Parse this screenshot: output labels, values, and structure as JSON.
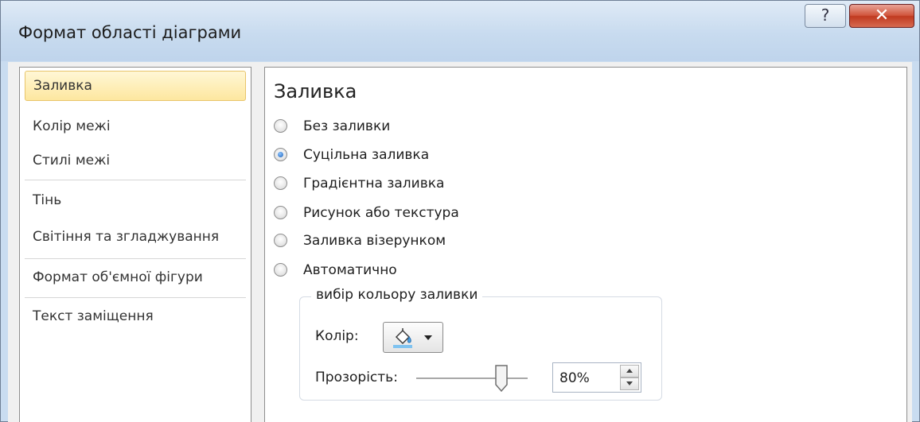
{
  "window": {
    "title": "Формат області діаграми",
    "help_glyph": "?",
    "close_glyph": "✕"
  },
  "sidebar": {
    "items": [
      {
        "label": "Заливка",
        "selected": true
      },
      {
        "label": "Колір межі",
        "selected": false
      },
      {
        "label": "Стилі межі",
        "selected": false
      },
      {
        "label": "Тінь",
        "selected": false
      },
      {
        "label": "Світіння та згладжування",
        "selected": false
      },
      {
        "label": "Формат об'ємної фігури",
        "selected": false
      },
      {
        "label": "Текст заміщення",
        "selected": false
      }
    ]
  },
  "content": {
    "section_title": "Заливка",
    "options": [
      {
        "label": "Без заливки",
        "selected": false
      },
      {
        "label": "Суцільна заливка",
        "selected": true
      },
      {
        "label": "Градієнтна заливка",
        "selected": false
      },
      {
        "label": "Рисунок або текстура",
        "selected": false
      },
      {
        "label": "Заливка візерунком",
        "selected": false
      },
      {
        "label": "Автоматично",
        "selected": false
      }
    ],
    "group": {
      "legend": "вибір кольору заливки",
      "color_label": "Колір:",
      "color_icon": "paint-bucket-icon",
      "transparency_label": "Прозорість:",
      "transparency_value": "80%",
      "transparency_fraction": 0.8
    }
  },
  "colors": {
    "accent_selected": "#fde79f",
    "close_red": "#c03a20",
    "radio_blue": "#1a5fb8"
  }
}
